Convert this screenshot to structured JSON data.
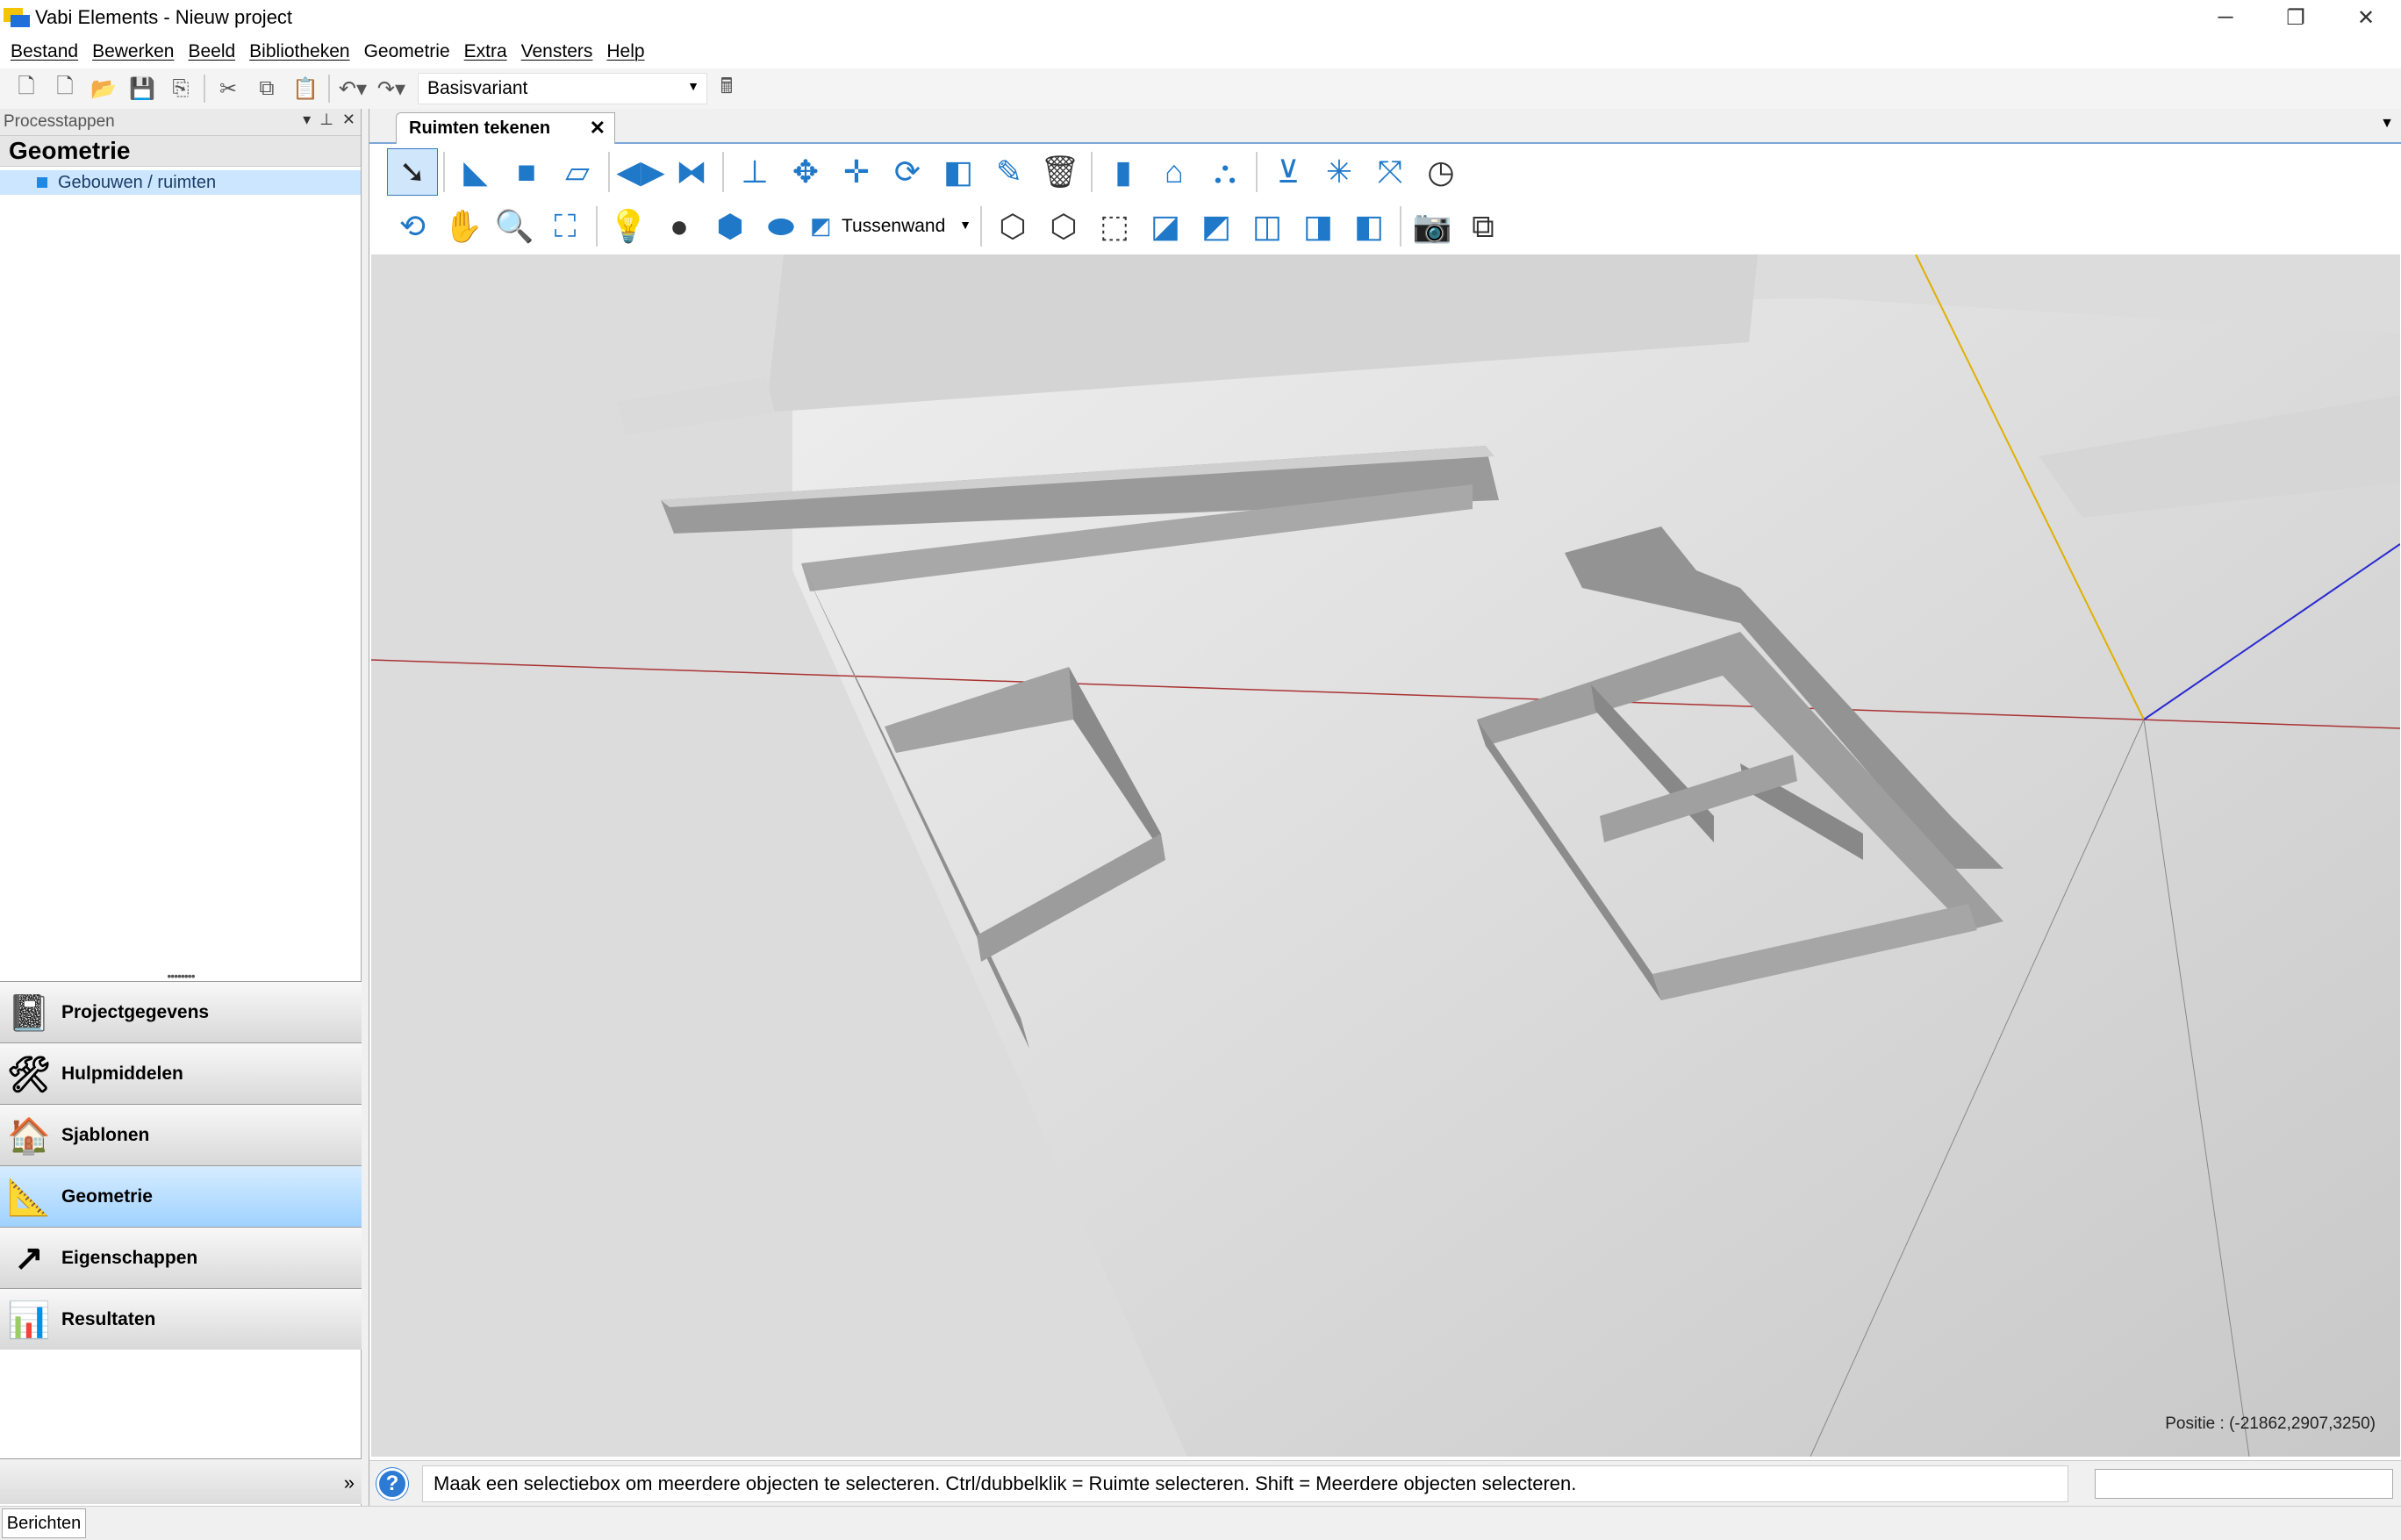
{
  "window": {
    "title": "Vabi Elements - Nieuw project",
    "minimize": "─",
    "restore": "❐",
    "close": "✕"
  },
  "menu": [
    "Bestand",
    "Bewerken",
    "Beeld",
    "Bibliotheken",
    "Geometrie",
    "Extra",
    "Vensters",
    "Help"
  ],
  "toolbar": {
    "variant": "Basisvariant"
  },
  "left_panel": {
    "header": "Processtappen",
    "title": "Geometrie",
    "tree_item": "Gebouwen / ruimten",
    "nav": [
      "Projectgegevens",
      "Hulpmiddelen",
      "Sjablonen",
      "Geometrie",
      "Eigenschappen",
      "Resultaten"
    ],
    "active_nav": "Geometrie"
  },
  "doc": {
    "tab": "Ruimten tekenen",
    "face_type": "Tussenwand",
    "position": "Positie : (-21862,2907,3250)"
  },
  "status": {
    "message": "Maak een selectiebox om meerdere objecten te selecteren. Ctrl/dubbelklik = Ruimte selecteren. Shift = Meerdere objecten selecteren."
  },
  "bottom": {
    "tab": "Berichten"
  },
  "icons": {
    "toolbar": [
      "new-icon",
      "new-from-template-icon",
      "open-icon",
      "save-icon",
      "save-as-icon",
      "cut-icon",
      "copy-icon",
      "paste-icon",
      "undo-icon",
      "redo-icon",
      "calculator-icon"
    ],
    "tools_row1": [
      "select-icon",
      "draw-lshape-icon",
      "draw-rect-icon",
      "draw-polygon-icon",
      "split-icon",
      "merge-icon",
      "extrude-icon",
      "move-icon",
      "move-copy-icon",
      "rotate-icon",
      "mirror-icon",
      "edit-icon",
      "delete-icon",
      "door-icon",
      "roof-icon",
      "group-icon",
      "measure-icon",
      "snap-icon",
      "axis-icon",
      "clock-icon"
    ],
    "tools_row2": [
      "orbit-icon",
      "pan-icon",
      "zoom-icon",
      "zoom-extents-icon",
      "light-on-icon",
      "light-off-icon",
      "solid-view-icon",
      "floor-view-icon",
      "view-iso-icon",
      "view-front-icon",
      "view-top-icon",
      "view-right-icon",
      "view-left-icon",
      "view-back-icon",
      "view-bottom-icon",
      "view-persp-icon",
      "camera-icon",
      "screenshot-icon"
    ]
  },
  "colors": {
    "accent": "#1f78c8",
    "active_nav": "#9fd2ff",
    "x_axis": "#a33",
    "y_axis": "#e0b000",
    "z_axis": "#2a2ad0"
  }
}
